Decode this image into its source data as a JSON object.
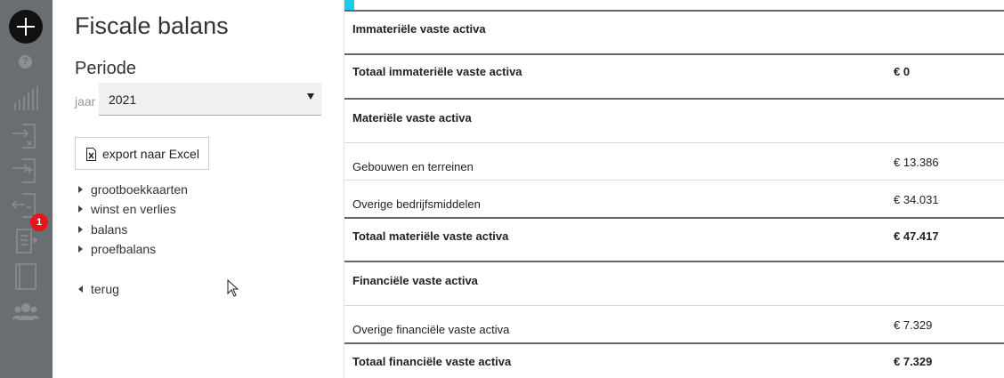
{
  "rail": {
    "icons": [
      "add-icon",
      "help-icon",
      "bar-chart-icon",
      "import-icon",
      "add-entry-icon",
      "export-icon",
      "documents-icon",
      "book-icon",
      "users-icon"
    ],
    "badge_count": "1"
  },
  "panel": {
    "title": "Fiscale balans",
    "periode_label": "Periode",
    "jaar_label": "jaar",
    "jaar_value": "2021",
    "export_label": "export naar Excel",
    "nav": [
      "grootboekkaarten",
      "winst en verlies",
      "balans",
      "proefbalans"
    ],
    "back_label": "terug"
  },
  "table": {
    "immaterieel": {
      "heading": "Immateriële vaste activa",
      "total_label": "Totaal immateriële vaste activa",
      "total_value": "€ 0"
    },
    "materieel": {
      "heading": "Materiële vaste activa",
      "rows": [
        {
          "label": "Gebouwen en terreinen",
          "value": "€ 13.386"
        },
        {
          "label": "Overige bedrijfsmiddelen",
          "value": "€ 34.031"
        }
      ],
      "total_label": "Totaal materiële vaste activa",
      "total_value": "€ 47.417"
    },
    "financieel": {
      "heading": "Financiële vaste activa",
      "rows": [
        {
          "label": "Overige financiële vaste activa",
          "value": "€ 7.329"
        }
      ],
      "total_label": "Totaal financiële vaste activa",
      "total_value": "€ 7.329"
    }
  },
  "colors": {
    "rail": "#6b6e70",
    "accent": "#1fc9f0",
    "badge": "#e8141c"
  }
}
